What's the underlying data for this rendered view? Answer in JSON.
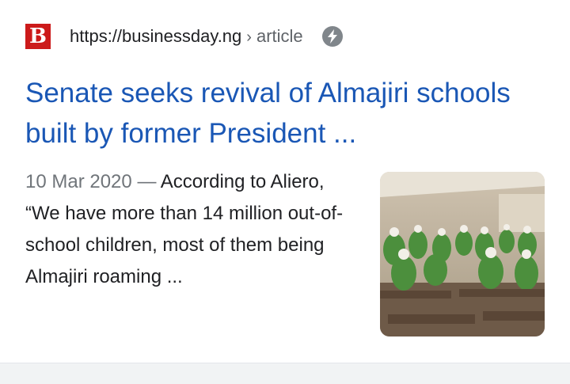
{
  "result": {
    "favicon_letter": "B",
    "url": "https://businessday.ng",
    "separator": "›",
    "breadcrumb": "article",
    "amp_icon": "lightning-bolt-icon",
    "title": "Senate seeks revival of Almajiri schools built by former President ...",
    "date": "10 Mar 2020",
    "date_separator": "—",
    "snippet": "According to Aliero, “We have more than 14 million out-of- school children, most of them being Almajiri roaming ...",
    "thumbnail_alt": "classroom with students in green uniforms"
  },
  "colors": {
    "title_link": "#1a57b5",
    "favicon_bg": "#cc1a1a",
    "body_text": "#202124",
    "muted_text": "#70757a"
  }
}
